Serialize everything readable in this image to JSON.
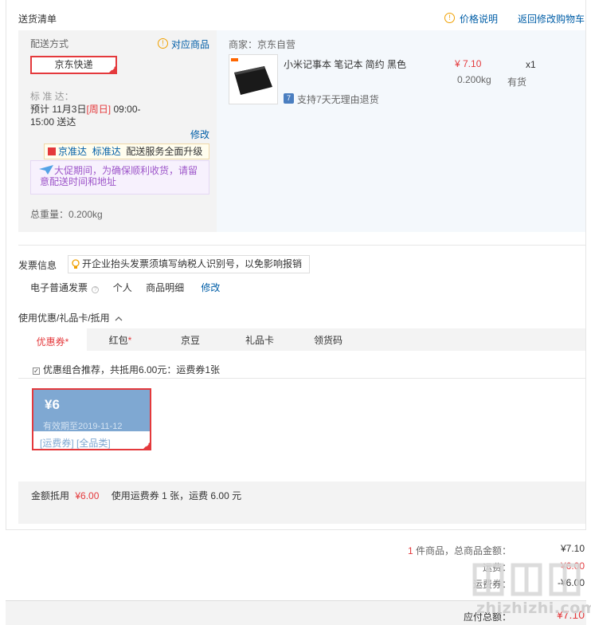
{
  "delivery": {
    "section_title": "送货清单",
    "price_help": "价格说明",
    "back_to_cart": "返回修改购物车",
    "ship_method_label": "配送方式",
    "matching_goods": "对应商品",
    "ship_option": "京东快递",
    "std_label": "标 准 达：",
    "eta_line1": "预计 11月3日",
    "eta_weekday": "[周日]",
    "eta_time": " 09:00-",
    "eta_line2": "15:00 送达",
    "modify": "修改",
    "upgrade_badge1": "京准达",
    "upgrade_badge2": "标准达",
    "upgrade_text": "配送服务全面升级",
    "promo_notice": "大促期间，为确保顺利收货，请留意配送时间和地址",
    "total_weight": "总重量：0.200kg",
    "merchant": "商家：京东自营",
    "product_name": "小米记事本 笔记本 简约 黑色",
    "price": "¥ 7.10",
    "weight": "0.200kg",
    "qty": "x1",
    "stock": "有货",
    "return_policy": "支持7天无理由退货"
  },
  "invoice": {
    "label": "发票信息",
    "tip": "开企业抬头发票须填写纳税人识别号，以免影响报销",
    "type": "电子普通发票",
    "title": "个人",
    "content": "商品明细",
    "modify": "修改"
  },
  "discount": {
    "header": "使用优惠/礼品卡/抵用",
    "tabs": [
      {
        "label": "优惠券",
        "star": "*"
      },
      {
        "label": "红包",
        "star": "*"
      },
      {
        "label": "京豆",
        "star": ""
      },
      {
        "label": "礼品卡",
        "star": ""
      },
      {
        "label": "领货码",
        "star": ""
      }
    ],
    "combo_tip": "优惠组合推荐，共抵用6.00元：运费券1张",
    "coupon": {
      "amount": "¥6",
      "expiry": "有效期至2019-11-12",
      "tags": "[运费券] [全品类]"
    },
    "summary_label": "金额抵用",
    "summary_amount": "¥6.00",
    "summary_detail": "使用运费券 1 张，运费 6.00 元"
  },
  "totals": {
    "count": "1",
    "count_suffix": " 件商品，总商品金额：",
    "goods_total": "¥7.10",
    "shipping_label": "运费：",
    "shipping_value": "¥6.00",
    "coupon_label": "运费券：",
    "coupon_value": "-¥6.00",
    "payable_label": "应付总额：",
    "payable_value": "¥7.10"
  },
  "watermark": "zhizhizhi.com",
  "colors": {
    "accent": "#e4393c",
    "link": "#005ea7",
    "coupon_blue": "#7fa8d2"
  }
}
